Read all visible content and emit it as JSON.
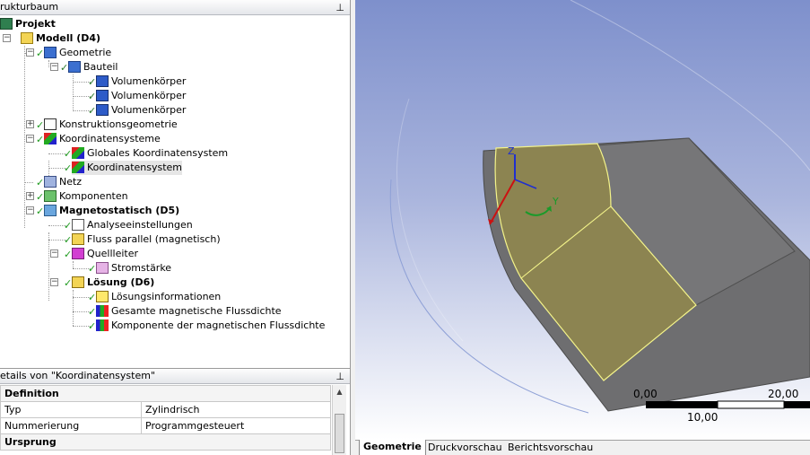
{
  "tree_panel": {
    "title": "rukturbaum",
    "pin": "⊥"
  },
  "tree": [
    {
      "id": "projekt",
      "label": "Projekt",
      "bold": true
    },
    {
      "id": "modell",
      "label": "Modell (D4)",
      "bold": true
    },
    {
      "id": "geometrie",
      "label": "Geometrie"
    },
    {
      "id": "bauteil",
      "label": "Bauteil"
    },
    {
      "id": "vk1",
      "label": "Volumenkörper"
    },
    {
      "id": "vk2",
      "label": "Volumenkörper"
    },
    {
      "id": "vk3",
      "label": "Volumenkörper"
    },
    {
      "id": "konstgeo",
      "label": "Konstruktionsgeometrie"
    },
    {
      "id": "koordsys",
      "label": "Koordinatensysteme"
    },
    {
      "id": "globkoord",
      "label": "Globales Koordinatensystem"
    },
    {
      "id": "koord",
      "label": "Koordinatensystem"
    },
    {
      "id": "netz",
      "label": "Netz"
    },
    {
      "id": "komponenten",
      "label": "Komponenten"
    },
    {
      "id": "magneto",
      "label": "Magnetostatisch (D5)",
      "bold": true
    },
    {
      "id": "analyse",
      "label": "Analyseeinstellungen"
    },
    {
      "id": "fluss",
      "label": "Fluss parallel (magnetisch)"
    },
    {
      "id": "quell",
      "label": "Quellleiter"
    },
    {
      "id": "strom",
      "label": "Stromstärke"
    },
    {
      "id": "loesung",
      "label": "Lösung (D6)",
      "bold": true
    },
    {
      "id": "loesinfo",
      "label": "Lösungsinformationen"
    },
    {
      "id": "gesamt",
      "label": "Gesamte magnetische Flussdichte"
    },
    {
      "id": "komp",
      "label": "Komponente der magnetischen Flussdichte"
    }
  ],
  "details_panel": {
    "title": "etails von \"Koordinatensystem\"",
    "pin": "⊥",
    "rows": [
      {
        "section": true,
        "label": "Definition",
        "value": ""
      },
      {
        "label": "Typ",
        "value": "Zylindrisch"
      },
      {
        "label": "Nummerierung",
        "value": "Programmgesteuert"
      },
      {
        "section": true,
        "label": "Ursprung",
        "value": ""
      }
    ]
  },
  "viewport": {
    "triad": {
      "z": "Z",
      "y": "Y"
    },
    "scale": {
      "left": "0,00",
      "right": "20,00",
      "mid": "10,00"
    }
  },
  "tabs": [
    "Geometrie",
    "Druckvorschau",
    "Berichtsvorschau"
  ],
  "colors": {
    "background_top": "#8a9bd1",
    "body": "#737373",
    "selection": "#8c8451",
    "edge": "#f4f48a"
  }
}
